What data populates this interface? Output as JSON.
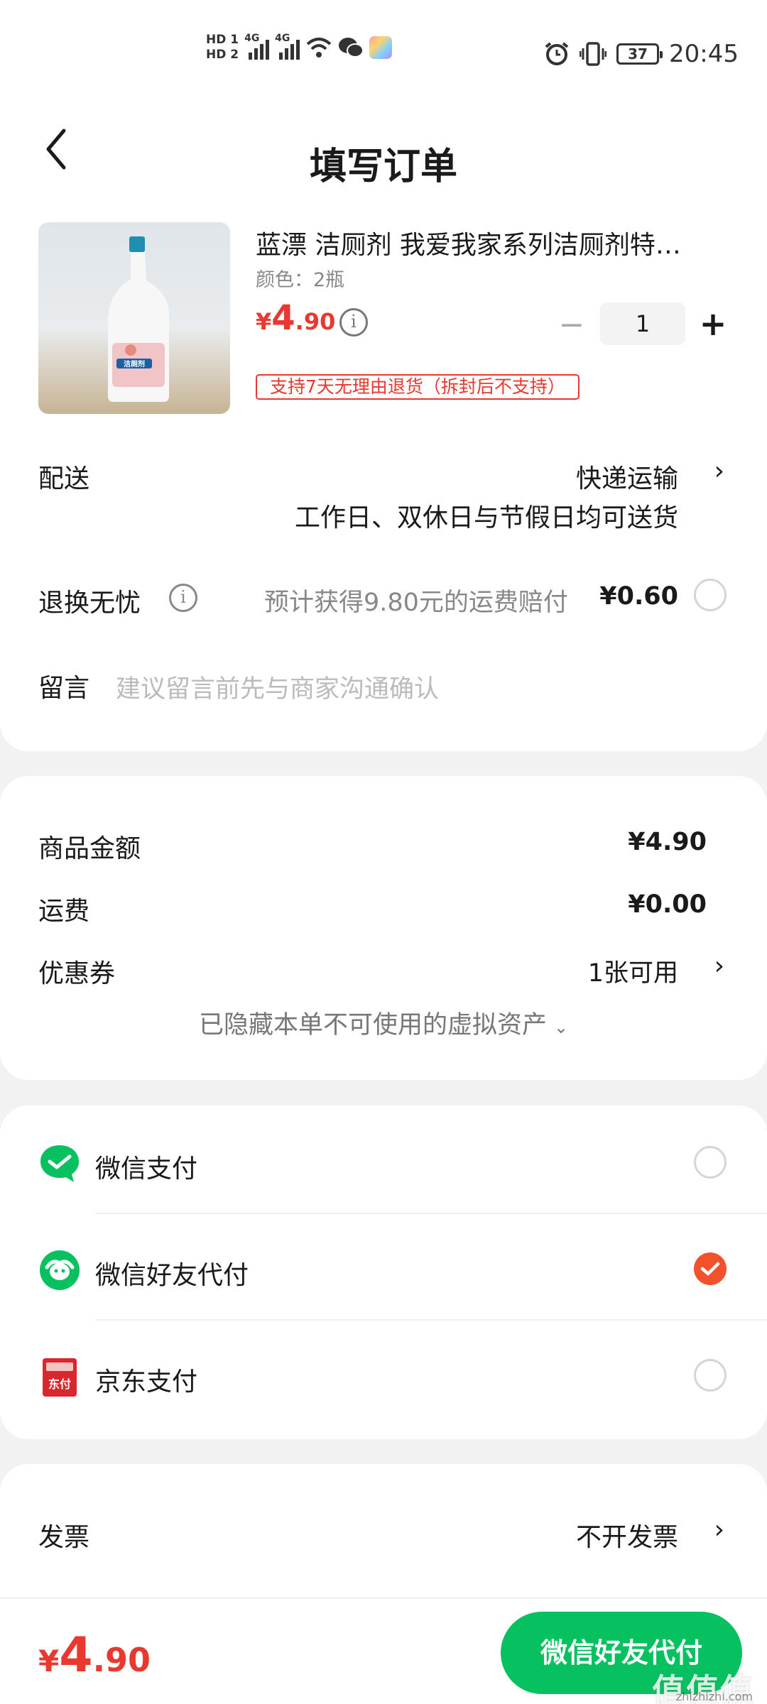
{
  "status_bar": {
    "hd1": "HD 1",
    "hd2": "HD 2",
    "net1": "4G",
    "net2": "4G",
    "battery": "37",
    "time": "20:45"
  },
  "header": {
    "title": "填写订单"
  },
  "product": {
    "title": "蓝漂 洁厕剂 我爱我家系列洁厕剂特…",
    "spec": "颜色：2瓶",
    "price_currency": "¥",
    "price_int": "4",
    "price_dec": ".90",
    "quantity": "1",
    "return_badge": "支持7天无理由退货（拆封后不支持）",
    "bottle_label": "洁厕剂"
  },
  "delivery": {
    "label": "配送",
    "method": "快递运输",
    "note": "工作日、双休日与节假日均可送货"
  },
  "return_insurance": {
    "label": "退换无忧",
    "desc": "预计获得9.80元的运费赔付",
    "price": "¥0.60"
  },
  "remark": {
    "label": "留言",
    "placeholder": "建议留言前先与商家沟通确认"
  },
  "amounts": {
    "goods_label": "商品金额",
    "goods_value": "¥4.90",
    "shipping_label": "运费",
    "shipping_value": "¥0.00",
    "coupon_label": "优惠券",
    "coupon_value": "1张可用",
    "hidden_note": "已隐藏本单不可使用的虚拟资产"
  },
  "payment": {
    "options": [
      {
        "label": "微信支付",
        "icon": "wechat-pay-icon",
        "selected": false
      },
      {
        "label": "微信好友代付",
        "icon": "wechat-friend-pay-icon",
        "selected": true
      },
      {
        "label": "京东支付",
        "icon": "jd-pay-icon",
        "selected": false,
        "icon_text": "东付"
      }
    ]
  },
  "invoice": {
    "label": "发票",
    "value": "不开发票"
  },
  "bottom": {
    "total_currency": "¥",
    "total_int": "4",
    "total_dec": ".90",
    "pay_button": "微信好友代付"
  },
  "watermark": {
    "text": "值值值",
    "sub": "zhizhizhi.com"
  },
  "colors": {
    "accent_red": "#e8382f",
    "wechat_green": "#07c160",
    "radio_checked": "#f2512c"
  }
}
